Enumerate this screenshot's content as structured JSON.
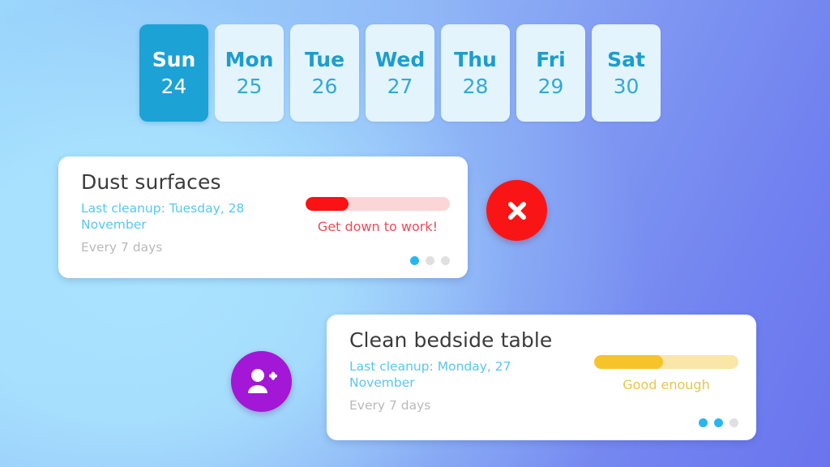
{
  "background": {
    "gradient_from": "#A9E3FE",
    "gradient_to": "#6A74EE"
  },
  "day_strip": {
    "days": [
      {
        "name": "Sun",
        "number": "24",
        "selected": true
      },
      {
        "name": "Mon",
        "number": "25",
        "selected": false
      },
      {
        "name": "Tue",
        "number": "26",
        "selected": false
      },
      {
        "name": "Wed",
        "number": "27",
        "selected": false
      },
      {
        "name": "Thu",
        "number": "28",
        "selected": false
      },
      {
        "name": "Fri",
        "number": "29",
        "selected": false
      },
      {
        "name": "Sat",
        "number": "30",
        "selected": false
      }
    ],
    "selected_bg": "#1CA2D4",
    "unselected_bg": "#E3F4FC",
    "unselected_text": "#1D9DCE"
  },
  "tasks": [
    {
      "title": "Dust surfaces",
      "last_cleanup": "Last cleanup: Tuesday, 28 November",
      "frequency": "Every 7 days",
      "progress_label": "Get down to work!",
      "progress_percent": 30,
      "progress_fill_color": "#FA1215",
      "progress_track_color": "#FBD6D7",
      "progress_label_color": "#EE4B58",
      "dots": [
        true,
        false,
        false
      ]
    },
    {
      "title": "Clean bedside table",
      "last_cleanup": "Last cleanup: Monday, 27 November",
      "frequency": "Every 7 days",
      "progress_label": "Good enough",
      "progress_percent": 48,
      "progress_fill_color": "#F6C32A",
      "progress_track_color": "#FBE6A9",
      "progress_label_color": "#E9C54B",
      "dots": [
        true,
        true,
        false
      ]
    }
  ],
  "actions": {
    "close": {
      "icon": "close-icon",
      "color": "#F91515"
    },
    "add_user": {
      "icon": "person-plus-icon",
      "color": "#A317D6"
    }
  }
}
